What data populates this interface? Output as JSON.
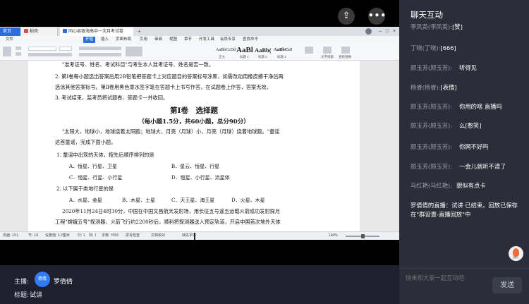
{
  "wps": {
    "tabs": [
      {
        "label": "首页"
      },
      {
        "label": "稻壳"
      },
      {
        "label": "同心县银海高中一次月考试卷"
      }
    ],
    "menu": [
      {
        "label": "文件"
      },
      {
        "label": "开始"
      },
      {
        "label": "插入"
      },
      {
        "label": "页面布局"
      },
      {
        "label": "引用"
      },
      {
        "label": "审阅"
      },
      {
        "label": "视图"
      },
      {
        "label": "章节"
      },
      {
        "label": "开发工具"
      },
      {
        "label": "会员专享"
      },
      {
        "label": "查找命令"
      }
    ],
    "styles": [
      {
        "sample": "AaBbCcDd",
        "caption": "正文"
      },
      {
        "sample": "AaBl",
        "caption": "标题 1"
      },
      {
        "sample": "AaBb(",
        "caption": "标题 2"
      },
      {
        "sample": "AaBbCcI",
        "caption": "标题 3"
      }
    ],
    "ribbon_right": [
      {
        "label": "文字排版"
      },
      {
        "label": "查找替换"
      }
    ],
    "status": {
      "page": "页面: 1/11",
      "section": "节: 1/1",
      "position": "设置值: 3.2厘米",
      "line": "行: 1",
      "col": "列: 1",
      "words": "字数: 7059",
      "spell": "拼写检查",
      "doc_check": "文档校对",
      "font_missing": "缺失字体",
      "zoom": "140%"
    }
  },
  "doc": {
    "lines": [
      "\"准考证号、姓名、考试科目\"与考生本人准考证号、姓名是否一致。",
      "2. 第Ⅰ卷每小题选出答案后用2B铅笔把答题卡上对应题目的答案标号涂黑，如需改动用橡皮擦干净后再",
      "选涂其他答案标号。第Ⅱ卷用黑色墨水签字笔在答题卡上书写作答，在试题卷上作答，答案无效。",
      "3. 考试结束，监考员将试题卷、答题卡一并收回。"
    ],
    "section_title": "第Ⅰ卷　选择题",
    "section_sub": "（每小题1.5分，共60小题，总分90分）",
    "intro_1": "\"太阳大，地球小，地球绕着太阳跑；地球大，月亮（月球）小，月亮（月球）绕着地球跑。\"童谣",
    "intro_2": "这首童谣，完成下面小题。",
    "q1": "1. 童谣中出现的天体，按先后顺序排列的是",
    "q1_options": [
      "A．恒星、行星、卫星",
      "B．星云、恒星、行星",
      "C．恒星、行星、小行星",
      "D．恒星、小行星、流星体"
    ],
    "q2": "2. 以下属于类地行星的是",
    "q2_options": [
      "A．水星、金星",
      "B．木星、土星",
      "C．天王星、海王星",
      "D．火星、木星"
    ],
    "para_1": "2020年11月24日4时30分，中国在中国文昌航天发射场，用长征五号遥五运载火箭成功发射探月",
    "para_2": "工程\"嫦娥五号\"探测器，火箭飞行约2200秒后，顺利将探测器送入预定轨道，开启中国首次地外天体"
  },
  "info": {
    "host_label": "主播:",
    "host_avatar": "倩倩",
    "host_name": "罗倩倩",
    "title_label": "标题:",
    "title_value": "试讲"
  },
  "chat": {
    "title": "聊天互动",
    "messages": [
      {
        "name": "李凤英(李凤英):",
        "text": "[赞]"
      },
      {
        "name": "丁晓(丁晓):",
        "text": "[666]"
      },
      {
        "name": "顾玉芳(顾玉芳):",
        "text": "听得见"
      },
      {
        "name": "杨睿(杨睿):",
        "text": "[表情]"
      },
      {
        "name": "顾玉芳(顾玉芳):",
        "text": "你用的啥 直播吗"
      },
      {
        "name": "顾玉芳(顾玉芳):",
        "text": "么[憨笑]"
      },
      {
        "name": "顾玉芳(顾玉芳):",
        "text": "你网不好吗"
      },
      {
        "name": "顾玉芳(顾玉芳):",
        "text": "一会儿就听不清了"
      },
      {
        "name": "马红艳(马红艳):",
        "text": "貌似有点卡"
      }
    ],
    "system_message": "罗倩倩的直播：试讲 已结束。回放已保存在\"群设置-直播回放\"中",
    "like_count": "99+",
    "input_placeholder": "快来和大家一起互动吧",
    "send_label": "发送"
  }
}
